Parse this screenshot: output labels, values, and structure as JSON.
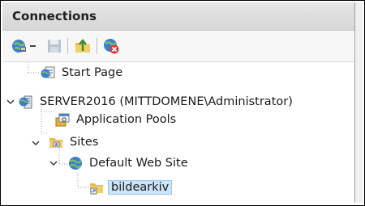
{
  "panel": {
    "title": "Connections"
  },
  "toolbar": {
    "buttons": [
      {
        "icon": "connect-globe-icon"
      },
      {
        "icon": "dropdown-arrow-icon"
      },
      {
        "icon": "save-icon"
      },
      {
        "icon": "up-folder-icon"
      },
      {
        "icon": "disconnect-icon"
      }
    ]
  },
  "tree": {
    "start_page": "Start Page",
    "server": "SERVER2016 (MITTDOMENE\\Administrator)",
    "app_pools": "Application Pools",
    "sites": "Sites",
    "default_site": "Default Web Site",
    "app": "bildearkiv"
  },
  "colors": {
    "selection_bg": "#cce4f7",
    "selection_border": "#99c9ef",
    "header_bg": "#dcdcdc"
  }
}
